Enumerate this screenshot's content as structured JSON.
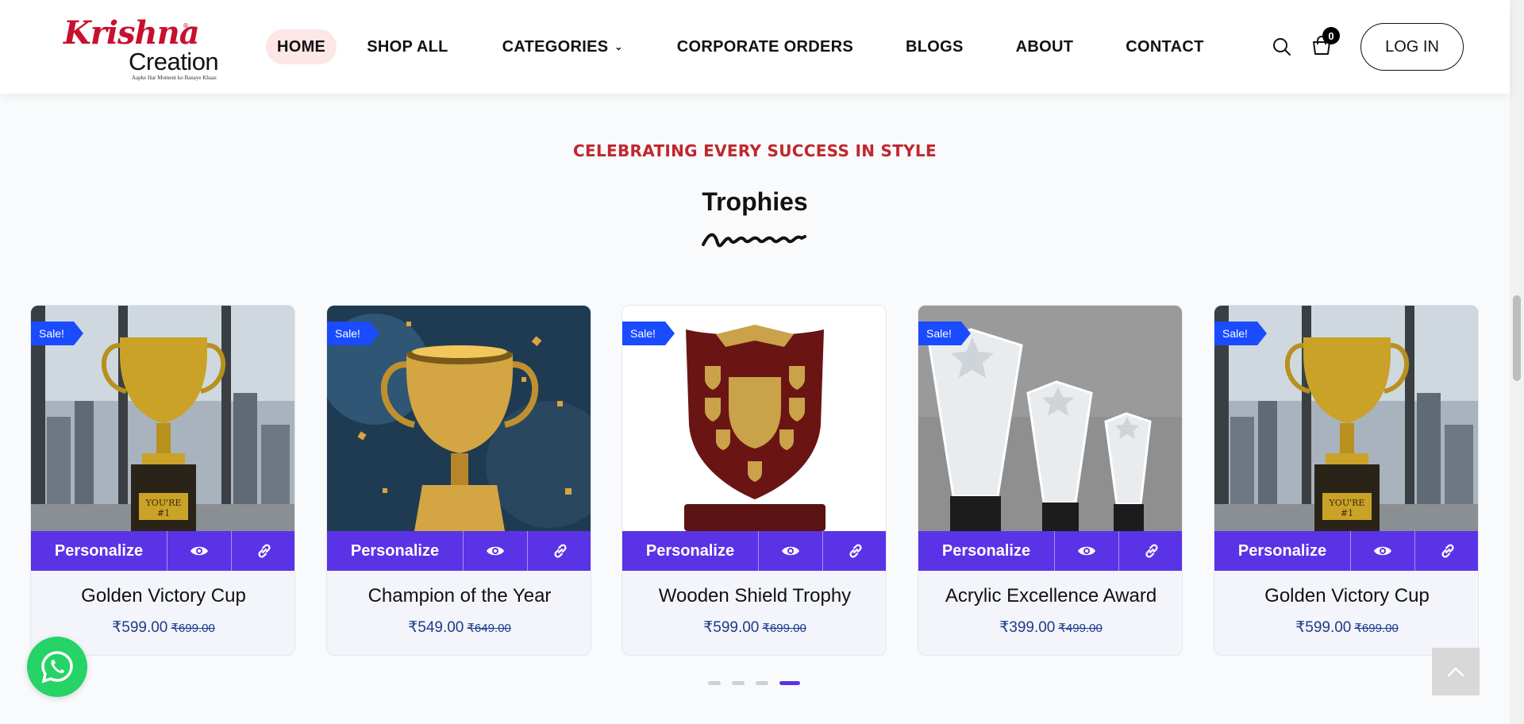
{
  "brand": {
    "name_top": "Krishna",
    "name_bottom": "Creation",
    "tagline": "Aapke Har Moment ko Banaye Khaas",
    "reg_mark": "®"
  },
  "nav": {
    "items": [
      {
        "label": "HOME",
        "active": true
      },
      {
        "label": "SHOP ALL"
      },
      {
        "label": "CATEGORIES",
        "has_dropdown": true
      },
      {
        "label": "CORPORATE ORDERS"
      },
      {
        "label": "BLOGS"
      },
      {
        "label": "ABOUT"
      },
      {
        "label": "CONTACT"
      }
    ],
    "dropdown_glyph": "⌄"
  },
  "header_actions": {
    "search_icon": "search-icon",
    "cart_icon": "shopping-bag-icon",
    "cart_count": "0",
    "login_label": "LOG IN"
  },
  "section": {
    "eyebrow": "CELEBRATING EVERY SUCCESS IN STYLE",
    "title": "Trophies"
  },
  "products": [
    {
      "badge": "Sale!",
      "name": "Golden Victory Cup",
      "price": "₹599.00",
      "old_price": "₹699.00",
      "image": "golden-cup-office-background"
    },
    {
      "badge": "Sale!",
      "name": "Champion of the Year",
      "price": "₹549.00",
      "old_price": "₹649.00",
      "image": "gold-trophy-confetti"
    },
    {
      "badge": "Sale!",
      "name": "Wooden Shield Trophy",
      "price": "₹599.00",
      "old_price": "₹699.00",
      "image": "wooden-shield-trophy"
    },
    {
      "badge": "Sale!",
      "name": "Acrylic Excellence Award",
      "price": "₹399.00",
      "old_price": "₹499.00",
      "image": "acrylic-star-awards"
    },
    {
      "badge": "Sale!",
      "name": "Golden Victory Cup",
      "price": "₹599.00",
      "old_price": "₹699.00",
      "image": "golden-cup-office-background"
    }
  ],
  "card_actions": {
    "personalize_label": "Personalize",
    "view_icon": "eye-icon",
    "link_icon": "link-icon"
  },
  "carousel": {
    "dot_count": 4,
    "active_index": 3
  },
  "colors": {
    "accent_purple": "#5b33e6",
    "sale_blue": "#1a4bff",
    "eyebrow_red": "#c0272d",
    "price_blue": "#1d3a8a",
    "whatsapp_green": "#25d366"
  }
}
